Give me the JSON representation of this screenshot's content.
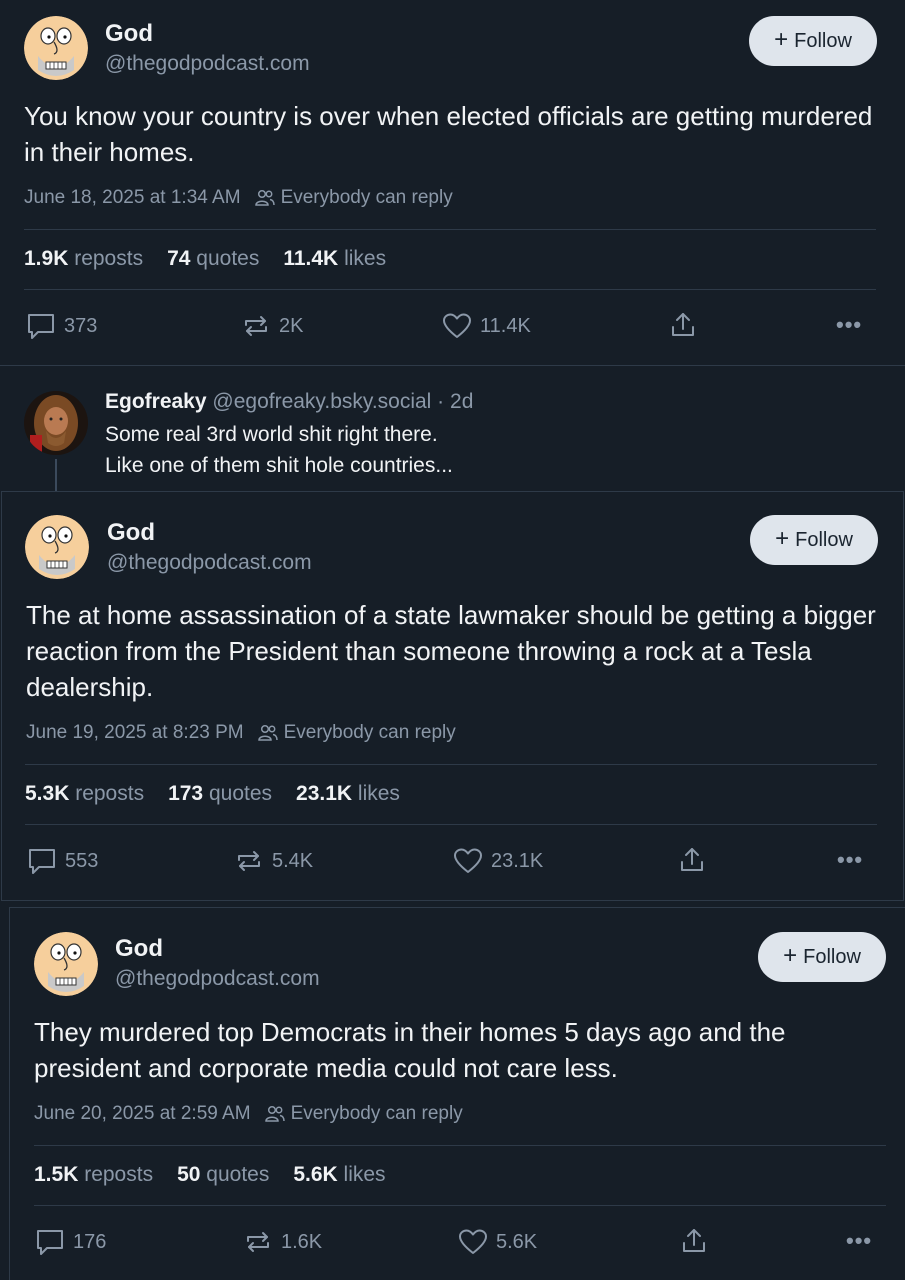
{
  "posts": [
    {
      "name": "God",
      "handle": "@thegodpodcast.com",
      "follow_label": "Follow",
      "text": "You know your country is over when elected officials are getting murdered in their homes.",
      "timestamp": "June 18, 2025 at 1:34 AM",
      "reply_setting": "Everybody can reply",
      "reposts": "1.9K",
      "reposts_label": "reposts",
      "quotes": "74",
      "quotes_label": "quotes",
      "likes": "11.4K",
      "likes_label": "likes",
      "reply_count": "373",
      "repost_count": "2K",
      "like_count": "11.4K"
    },
    {
      "name": "God",
      "handle": "@thegodpodcast.com",
      "follow_label": "Follow",
      "text": "The at home assassination of a state lawmaker should be getting a bigger reaction from the President than someone throwing a rock at a Tesla dealership.",
      "timestamp": "June 19, 2025 at 8:23 PM",
      "reply_setting": "Everybody can reply",
      "reposts": "5.3K",
      "reposts_label": "reposts",
      "quotes": "173",
      "quotes_label": "quotes",
      "likes": "23.1K",
      "likes_label": "likes",
      "reply_count": "553",
      "repost_count": "5.4K",
      "like_count": "23.1K"
    },
    {
      "name": "God",
      "handle": "@thegodpodcast.com",
      "follow_label": "Follow",
      "text": "They murdered top Democrats in their homes 5 days ago and the president and corporate media could not care less.",
      "timestamp": "June 20, 2025 at 2:59 AM",
      "reply_setting": "Everybody can reply",
      "reposts": "1.5K",
      "reposts_label": "reposts",
      "quotes": "50",
      "quotes_label": "quotes",
      "likes": "5.6K",
      "likes_label": "likes",
      "reply_count": "176",
      "repost_count": "1.6K",
      "like_count": "5.6K"
    }
  ],
  "reply": {
    "name": "Egofreaky",
    "handle_time": "@egofreaky.bsky.social · 2d",
    "line1": "Some real 3rd world shit right there.",
    "line2": "Like one of them shit hole countries..."
  },
  "colors": {
    "background": "#161e27",
    "text": "#f1f3f5",
    "muted": "#8b98a8",
    "follow_bg": "#dfe5ec"
  },
  "icons": [
    "reply-icon",
    "repost-icon",
    "like-icon",
    "share-icon",
    "more-icon",
    "people-icon"
  ]
}
